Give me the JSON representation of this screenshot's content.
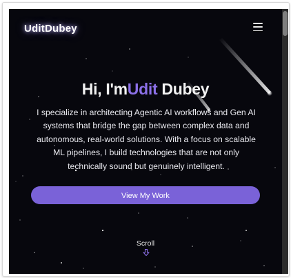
{
  "brand": {
    "logo_text": "UditDubey"
  },
  "nav": {
    "menu_icon": "hamburger-icon"
  },
  "hero": {
    "greeting": "Hi, I'm",
    "first_name": "Udit",
    "last_name": " Dubey",
    "description": "I specialize in architecting Agentic AI workflows and Gen AI systems that bridge the gap between complex data and autonomous, real-world solutions. With a focus on scalable ML pipelines, I build technologies that are not only technically sound but genuinely intelligent.",
    "cta_label": "View My Work"
  },
  "scroll_hint": {
    "label": "Scroll",
    "icon": "arrow-down-icon"
  },
  "colors": {
    "background": "#07070d",
    "accent": "#8b6fe6",
    "button": "#7a62d8",
    "text": "#f2f2f2"
  }
}
